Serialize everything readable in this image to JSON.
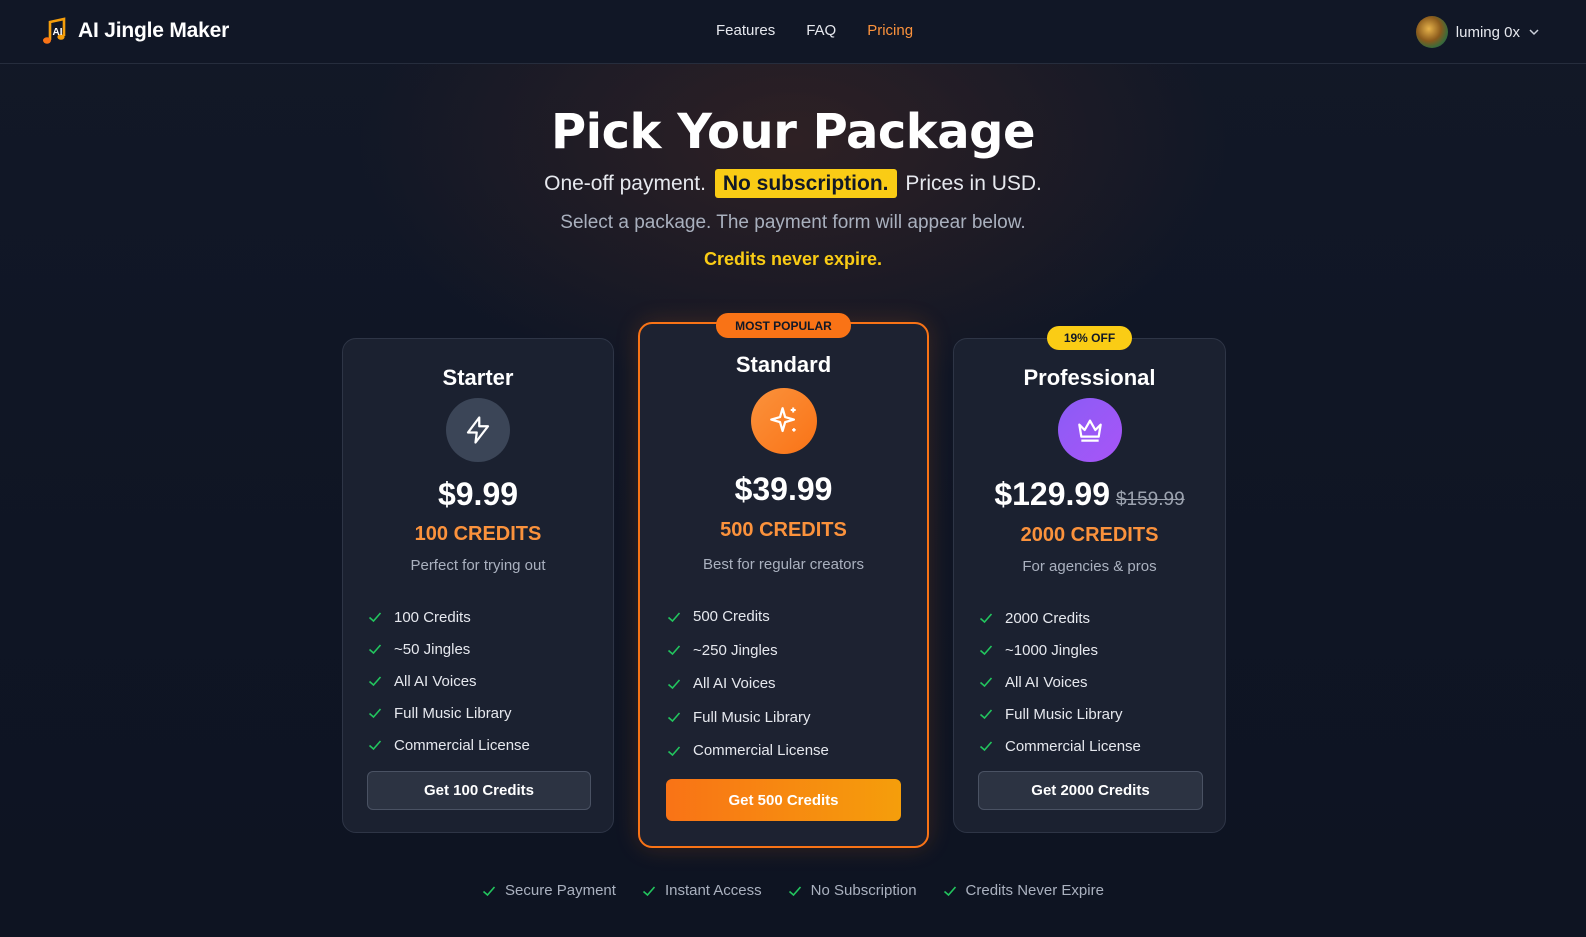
{
  "header": {
    "brand": "AI Jingle Maker",
    "nav": [
      {
        "label": "Features"
      },
      {
        "label": "FAQ"
      },
      {
        "label": "Pricing",
        "active": true
      }
    ],
    "user_name": "luming 0x"
  },
  "hero": {
    "title": "Pick Your Package",
    "sub_before": "One-off payment.",
    "sub_highlight": "No subscription.",
    "sub_after": "Prices in USD.",
    "instructions": "Select a package. The payment form will appear below.",
    "credits_note": "Credits never expire."
  },
  "plans": [
    {
      "name": "Starter",
      "icon": "lightning-icon",
      "price": "$9.99",
      "credits": "100 CREDITS",
      "description": "Perfect for trying out",
      "features": [
        "100 Credits",
        "~50 Jingles",
        "All AI Voices",
        "Full Music Library",
        "Commercial License"
      ],
      "button": "Get 100 Credits"
    },
    {
      "name": "Standard",
      "badge": "MOST POPULAR",
      "icon": "sparkle-icon",
      "price": "$39.99",
      "credits": "500 CREDITS",
      "description": "Best for regular creators",
      "features": [
        "500 Credits",
        "~250 Jingles",
        "All AI Voices",
        "Full Music Library",
        "Commercial License"
      ],
      "button": "Get 500 Credits"
    },
    {
      "name": "Professional",
      "badge": "19% OFF",
      "icon": "crown-icon",
      "price": "$129.99",
      "old_price": "$159.99",
      "credits": "2000 CREDITS",
      "description": "For agencies & pros",
      "features": [
        "2000 Credits",
        "~1000 Jingles",
        "All AI Voices",
        "Full Music Library",
        "Commercial License"
      ],
      "button": "Get 2000 Credits"
    }
  ],
  "trust": [
    "Secure Payment",
    "Instant Access",
    "No Subscription",
    "Credits Never Expire"
  ],
  "colors": {
    "accent": "#f97316",
    "highlight": "#facc15",
    "check": "#22c55e",
    "background": "#0f1524"
  }
}
